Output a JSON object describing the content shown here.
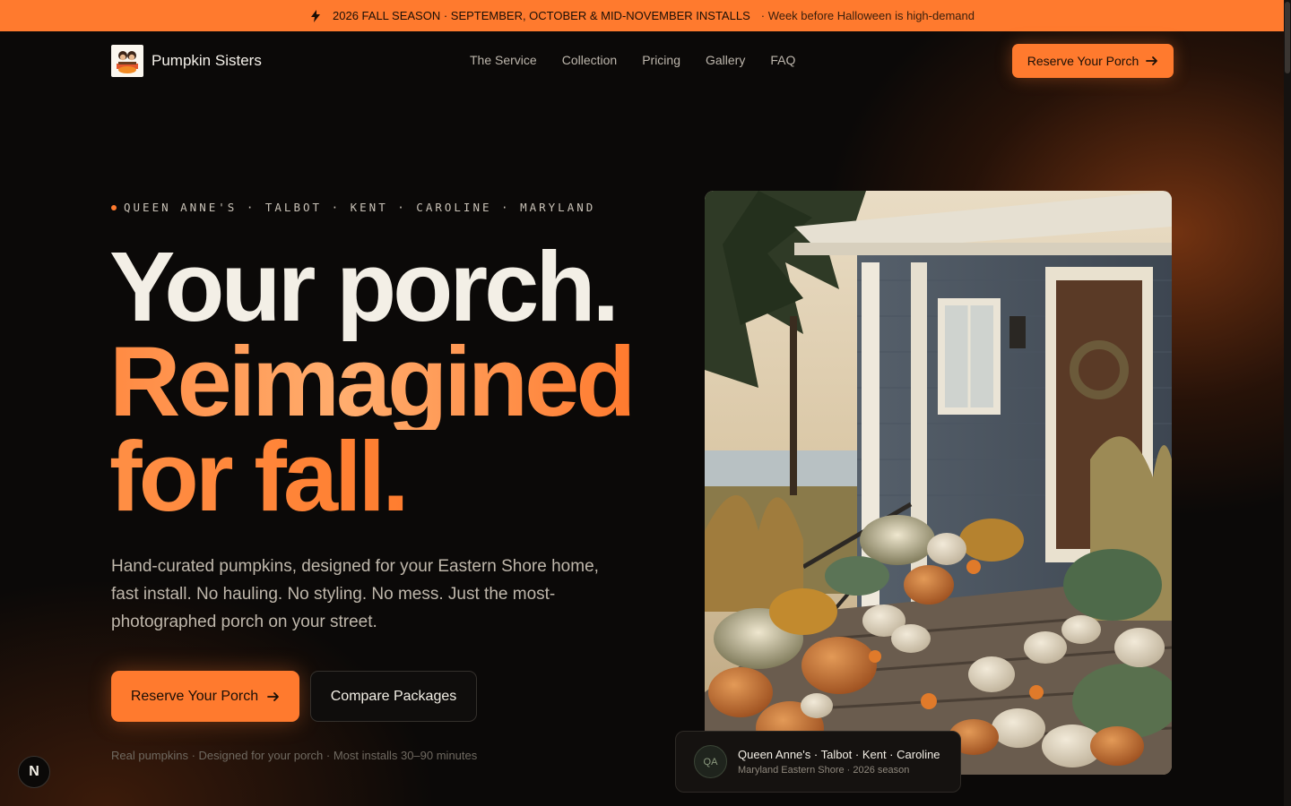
{
  "announcement": {
    "icon": "bolt-icon",
    "text": "2026 FALL SEASON · SEPTEMBER, OCTOBER & MID-NOVEMBER INSTALLS",
    "subtext": "· Week before Halloween is high-demand"
  },
  "nav": {
    "brand": "Pumpkin Sisters",
    "links": [
      "The Service",
      "Collection",
      "Pricing",
      "Gallery",
      "FAQ"
    ],
    "cta": "Reserve Your Porch"
  },
  "hero": {
    "eyebrow": "QUEEN ANNE'S · TALBOT · KENT · CAROLINE · MARYLAND",
    "headline_1": "Your porch.",
    "headline_2": "Reimagined",
    "headline_3": "for fall.",
    "lede": "Hand-curated pumpkins, designed for your Eastern Shore home, fast install. No hauling. No styling. No mess. Just the most-photographed porch on your street.",
    "primary_cta": "Reserve Your Porch",
    "secondary_cta": "Compare Packages",
    "footnote": "Real pumpkins · Designed for your porch · Most installs 30–90 minutes"
  },
  "location_card": {
    "avatar": "QA",
    "title": "Queen Anne's · Talbot · Kent · Caroline",
    "subtitle": "Maryland Eastern Shore · 2026 season"
  },
  "badge": {
    "letter": "N"
  },
  "colors": {
    "accent": "#ff7a2e",
    "background": "#0b0908",
    "text": "#f3efe6"
  }
}
